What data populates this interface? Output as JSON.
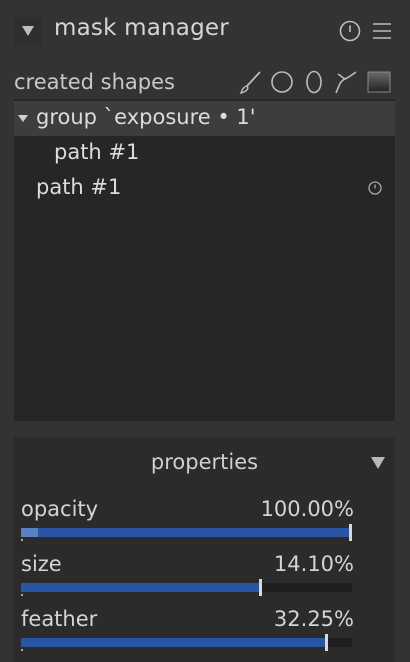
{
  "header": {
    "title": "mask manager"
  },
  "shapes": {
    "label": "created shapes"
  },
  "tools": [
    "brush-icon",
    "circle-icon",
    "ellipse-icon",
    "path-icon",
    "gradient-icon"
  ],
  "tree": {
    "items": [
      {
        "label": "group `exposure • 1'",
        "expanded": true,
        "selected": true
      },
      {
        "label": "path #1",
        "level": 2
      },
      {
        "label": "path #1",
        "level": 1,
        "icon": "power-icon"
      }
    ]
  },
  "properties": {
    "title": "properties",
    "sliders": [
      {
        "label": "opacity",
        "value": "100.00%",
        "fraction": 1.0,
        "soft_fraction": 0.05
      },
      {
        "label": "size",
        "value": "14.10%",
        "fraction": 0.718
      },
      {
        "label": "feather",
        "value": "32.25%",
        "fraction": 0.919
      }
    ]
  },
  "colors": {
    "accent": "#2a55a6",
    "background": "#333333",
    "panel": "#262626"
  }
}
